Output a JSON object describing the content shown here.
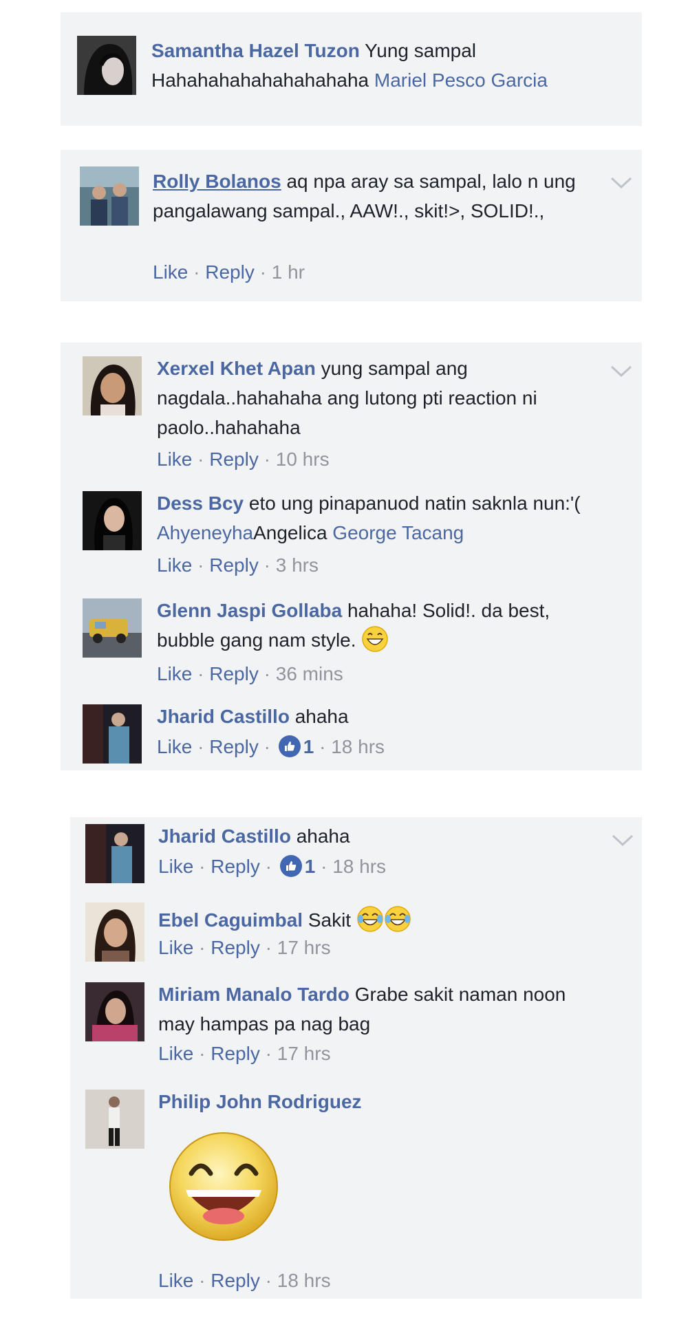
{
  "threads": [
    {
      "comments": [
        {
          "author": "Samantha Hazel Tuzon",
          "text": "Yung sampal Hahahahahahahahahaha",
          "mention": "Mariel Pesco Garcia",
          "avatar": "samantha-avatar"
        }
      ]
    },
    {
      "comments": [
        {
          "author": "Rolly Bolanos",
          "text": "aq npa aray sa sampal, lalo n ung pangalawang sampal., AAW!., skit!>, SOLID!.,",
          "time": "1 hr",
          "avatar": "rolly-avatar"
        }
      ]
    },
    {
      "comments": [
        {
          "author": "Xerxel Khet Apan",
          "text": "yung sampal ang nagdala..hahahaha ang lutong pti reaction ni paolo..hahahaha",
          "time": "10 hrs"
        },
        {
          "author": "Dess Bcy",
          "text": "eto ung pinapanuod natin saknla nun:'(",
          "mention_a": "Ahyeneyha",
          "plain_after": "Angelica",
          "mention_b": "George Tacang",
          "time": "3 hrs"
        },
        {
          "author": "Glenn Jaspi Gollaba",
          "text": "hahaha! Solid!. da best, bubble gang nam style.",
          "time": "36 mins",
          "emoji": "laughing-emoji"
        },
        {
          "author": "Jharid Castillo",
          "text": "ahaha",
          "likes": "1",
          "time": "18 hrs"
        }
      ]
    },
    {
      "comments": [
        {
          "author": "Jharid Castillo",
          "text": "ahaha",
          "likes": "1",
          "time": "18 hrs"
        },
        {
          "author": "Ebel Caguimbal",
          "text": "Sakit",
          "time": "17 hrs",
          "emoji": "tears-of-joy-emoji"
        },
        {
          "author": "Miriam Manalo Tardo",
          "text": "Grabe sakit naman noon may hampas pa nag bag",
          "time": "17 hrs"
        },
        {
          "author": "Philip John Rodriguez",
          "text": "",
          "time": "18 hrs",
          "sticker": "big-laughing-face-sticker"
        }
      ]
    }
  ],
  "actions": {
    "like": "Like",
    "reply": "Reply",
    "sep": "·"
  },
  "colors": {
    "card_bg": "#f2f3f5",
    "name": "#4b67a1",
    "text": "#1d2129",
    "meta": "#90949c",
    "like_badge": "#4267b2"
  }
}
